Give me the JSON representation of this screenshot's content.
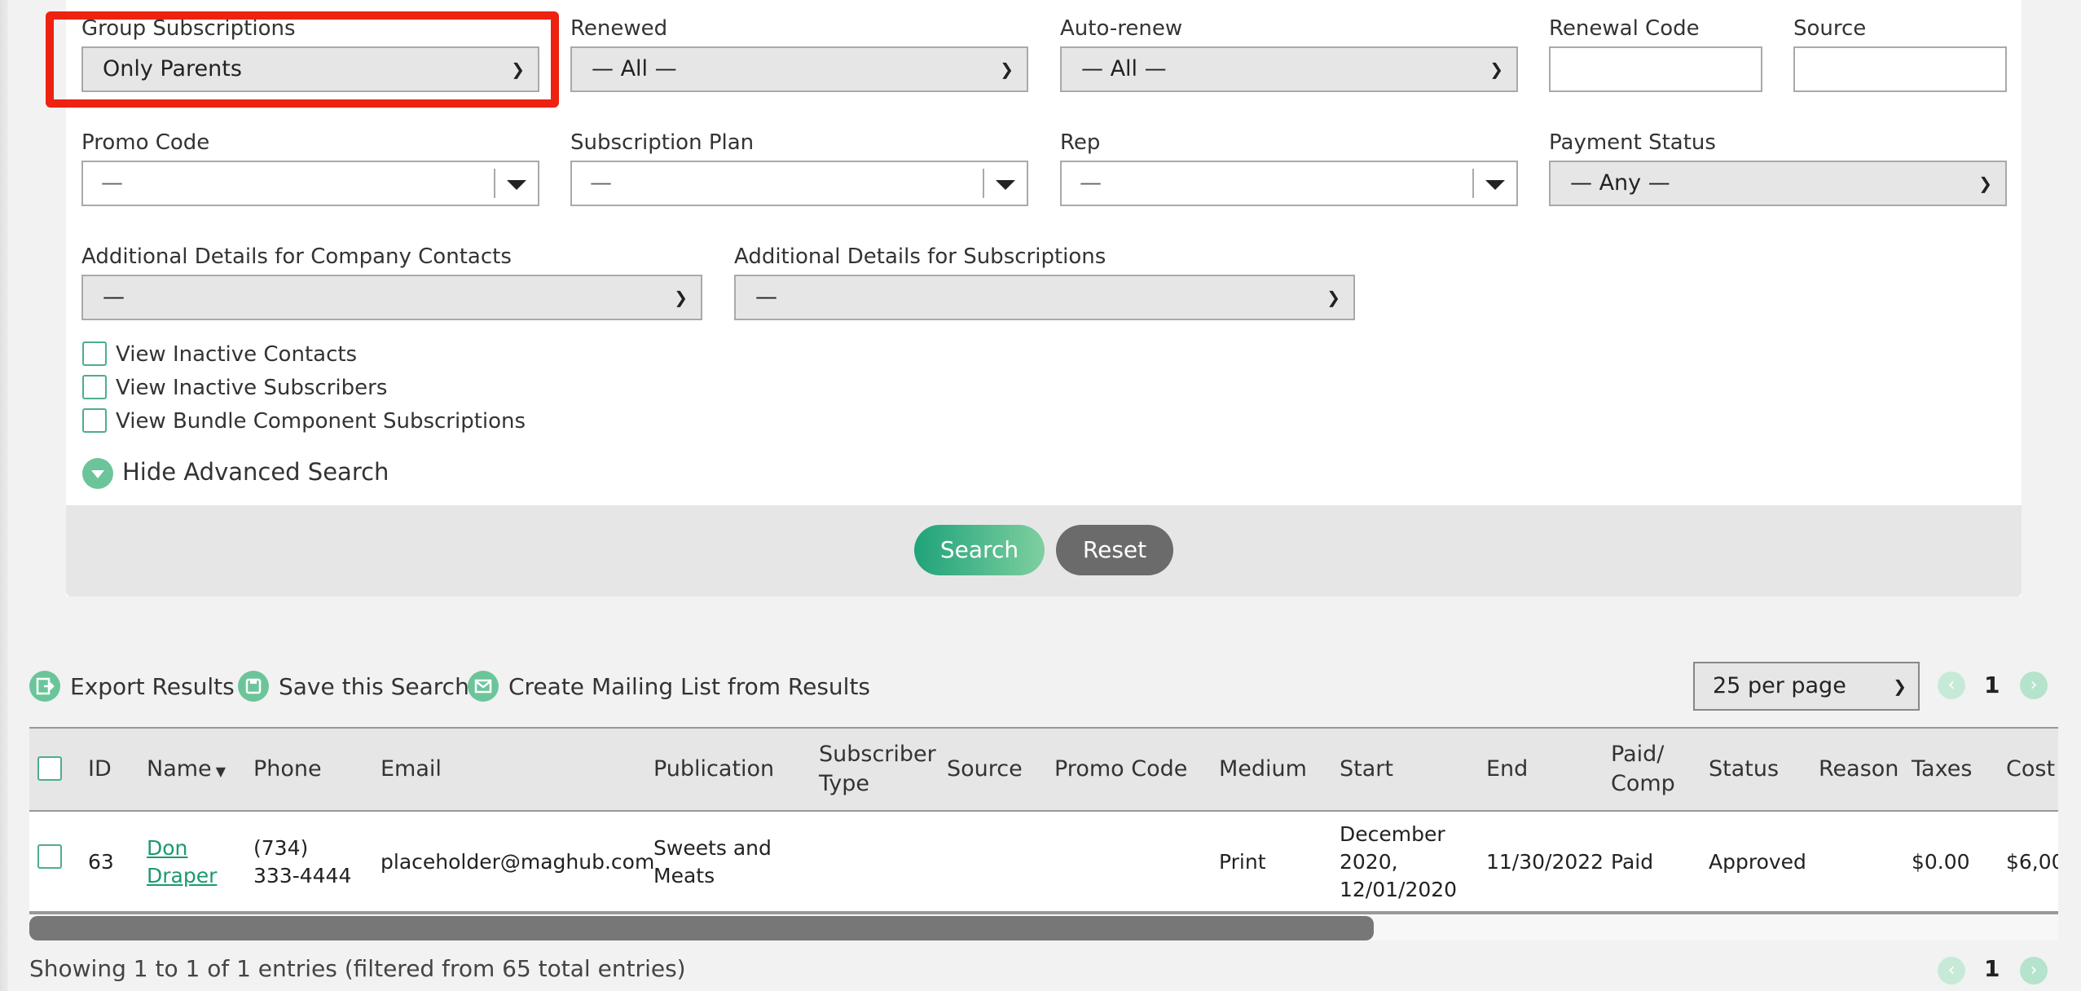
{
  "filters": {
    "group_subscriptions": {
      "label": "Group Subscriptions",
      "value": "Only Parents"
    },
    "renewed": {
      "label": "Renewed",
      "value": "— All —"
    },
    "auto_renew": {
      "label": "Auto-renew",
      "value": "— All —"
    },
    "renewal_code": {
      "label": "Renewal Code",
      "value": ""
    },
    "source": {
      "label": "Source",
      "value": ""
    },
    "promo_code": {
      "label": "Promo Code",
      "value": "—"
    },
    "subscription_plan": {
      "label": "Subscription Plan",
      "value": "—"
    },
    "rep": {
      "label": "Rep",
      "value": "—"
    },
    "payment_status": {
      "label": "Payment Status",
      "value": "— Any —"
    },
    "company_details": {
      "label": "Additional Details for Company Contacts",
      "value": "—"
    },
    "subscription_details": {
      "label": "Additional Details for Subscriptions",
      "value": "—"
    }
  },
  "checkboxes": [
    {
      "label": "View Inactive Contacts",
      "checked": false
    },
    {
      "label": "View Inactive Subscribers",
      "checked": false
    },
    {
      "label": "View Bundle Component Subscriptions",
      "checked": false
    }
  ],
  "advanced_toggle": "Hide Advanced Search",
  "buttons": {
    "search": "Search",
    "reset": "Reset"
  },
  "toolbar": {
    "export": "Export Results",
    "save_search": "Save this Search",
    "mailing_list": "Create Mailing List from Results",
    "per_page": "25 per page",
    "page": "1"
  },
  "table": {
    "headers": {
      "id": "ID",
      "name": "Name",
      "phone": "Phone",
      "email": "Email",
      "publication": "Publication",
      "subscriber_type": "Subscriber Type",
      "source": "Source",
      "promo_code": "Promo Code",
      "medium": "Medium",
      "start": "Start",
      "end": "End",
      "paid_comp": "Paid/ Comp",
      "status": "Status",
      "reason": "Reason",
      "taxes": "Taxes",
      "cost": "Cost"
    },
    "rows": [
      {
        "id": "63",
        "name": "Don Draper",
        "phone": "(734) 333-4444",
        "email": "placeholder@maghub.com",
        "publication": "Sweets and Meats",
        "subscriber_type": "",
        "source": "",
        "promo_code": "",
        "medium": "Print",
        "start": "December 2020, 12/01/2020",
        "end": "11/30/2022",
        "paid_comp": "Paid",
        "status": "Approved",
        "reason": "",
        "taxes": "$0.00",
        "cost": "$6,00"
      }
    ]
  },
  "footer": {
    "info": "Showing 1 to 1 of 1 entries (filtered from 65 total entries)",
    "page": "1"
  },
  "colors": {
    "accent": "#6cc59a",
    "highlight": "#ee2211",
    "link": "#1b9a6e"
  }
}
